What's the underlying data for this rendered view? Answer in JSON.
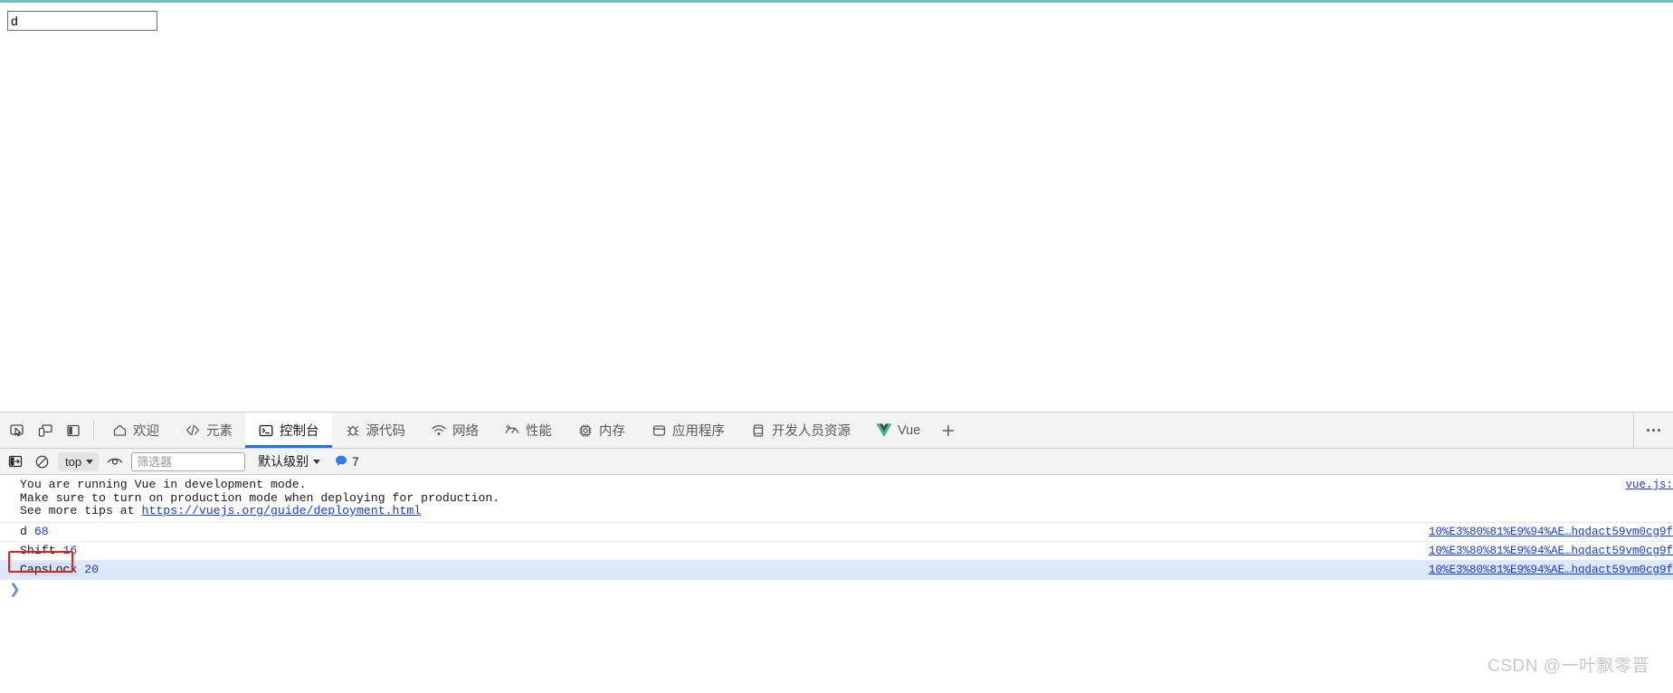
{
  "page": {
    "input_value": "d",
    "input_placeholder": ""
  },
  "devtools": {
    "tool_buttons": [
      {
        "name": "inspect-element-icon",
        "title": "检查"
      },
      {
        "name": "device-toolbar-icon",
        "title": "设备工具栏"
      },
      {
        "name": "dock-panel-icon",
        "title": "停靠面板"
      }
    ],
    "tabs": [
      {
        "label": "欢迎",
        "icon": "home-icon",
        "active": false
      },
      {
        "label": "元素",
        "icon": "code-brackets-icon",
        "active": false
      },
      {
        "label": "控制台",
        "icon": "console-terminal-icon",
        "active": true
      },
      {
        "label": "源代码",
        "icon": "bug-icon",
        "active": false
      },
      {
        "label": "网络",
        "icon": "wifi-icon",
        "active": false
      },
      {
        "label": "性能",
        "icon": "performance-meter-icon",
        "active": false
      },
      {
        "label": "内存",
        "icon": "memory-chip-icon",
        "active": false
      },
      {
        "label": "应用程序",
        "icon": "application-box-icon",
        "active": false
      },
      {
        "label": "开发人员资源",
        "icon": "document-icon",
        "active": false
      },
      {
        "label": "Vue",
        "icon": "vue-logo-icon",
        "active": false
      }
    ],
    "add_tab_label": "+",
    "more_menu_label": "⋯"
  },
  "console": {
    "toolbar": {
      "sidebar_toggle": "console-sidebar-icon",
      "clear_label": "clear-console-icon",
      "context": "top",
      "eye_icon": "live-expression-icon",
      "filter_placeholder": "筛选器",
      "filter_value": "",
      "level_label": "默认级别",
      "message_count": "7",
      "message_count_icon": "info-bubble-icon"
    },
    "group": {
      "lines": [
        "You are running Vue in development mode.",
        "Make sure to turn on production mode when deploying for production.",
        "See more tips at "
      ],
      "link_text": "https://vuejs.org/guide/deployment.html",
      "source": "vue.js:"
    },
    "rows": [
      {
        "key": "d",
        "code": "68",
        "source": "10%E3%80%81%E9%94%AE…hqdact59vm0cg9f",
        "selected": false,
        "highlighted": false
      },
      {
        "key": "Shift",
        "code": "16",
        "source": "10%E3%80%81%E9%94%AE…hqdact59vm0cg9f",
        "selected": false,
        "highlighted": false
      },
      {
        "key": "CapsLock",
        "code": "20",
        "source": "10%E3%80%81%E9%94%AE…hqdact59vm0cg9f",
        "selected": true,
        "highlighted": true
      }
    ],
    "prompt_symbol": "❯"
  },
  "watermark": "CSDN @一叶飘零晋",
  "colors": {
    "accent": "#1a73e8",
    "link": "#1a3ad4",
    "annotation": "#f01d1d",
    "selection": "#dce8fb",
    "vue_green": "#42b883",
    "vue_dark": "#35495e",
    "top_rule": "#79bec4"
  }
}
